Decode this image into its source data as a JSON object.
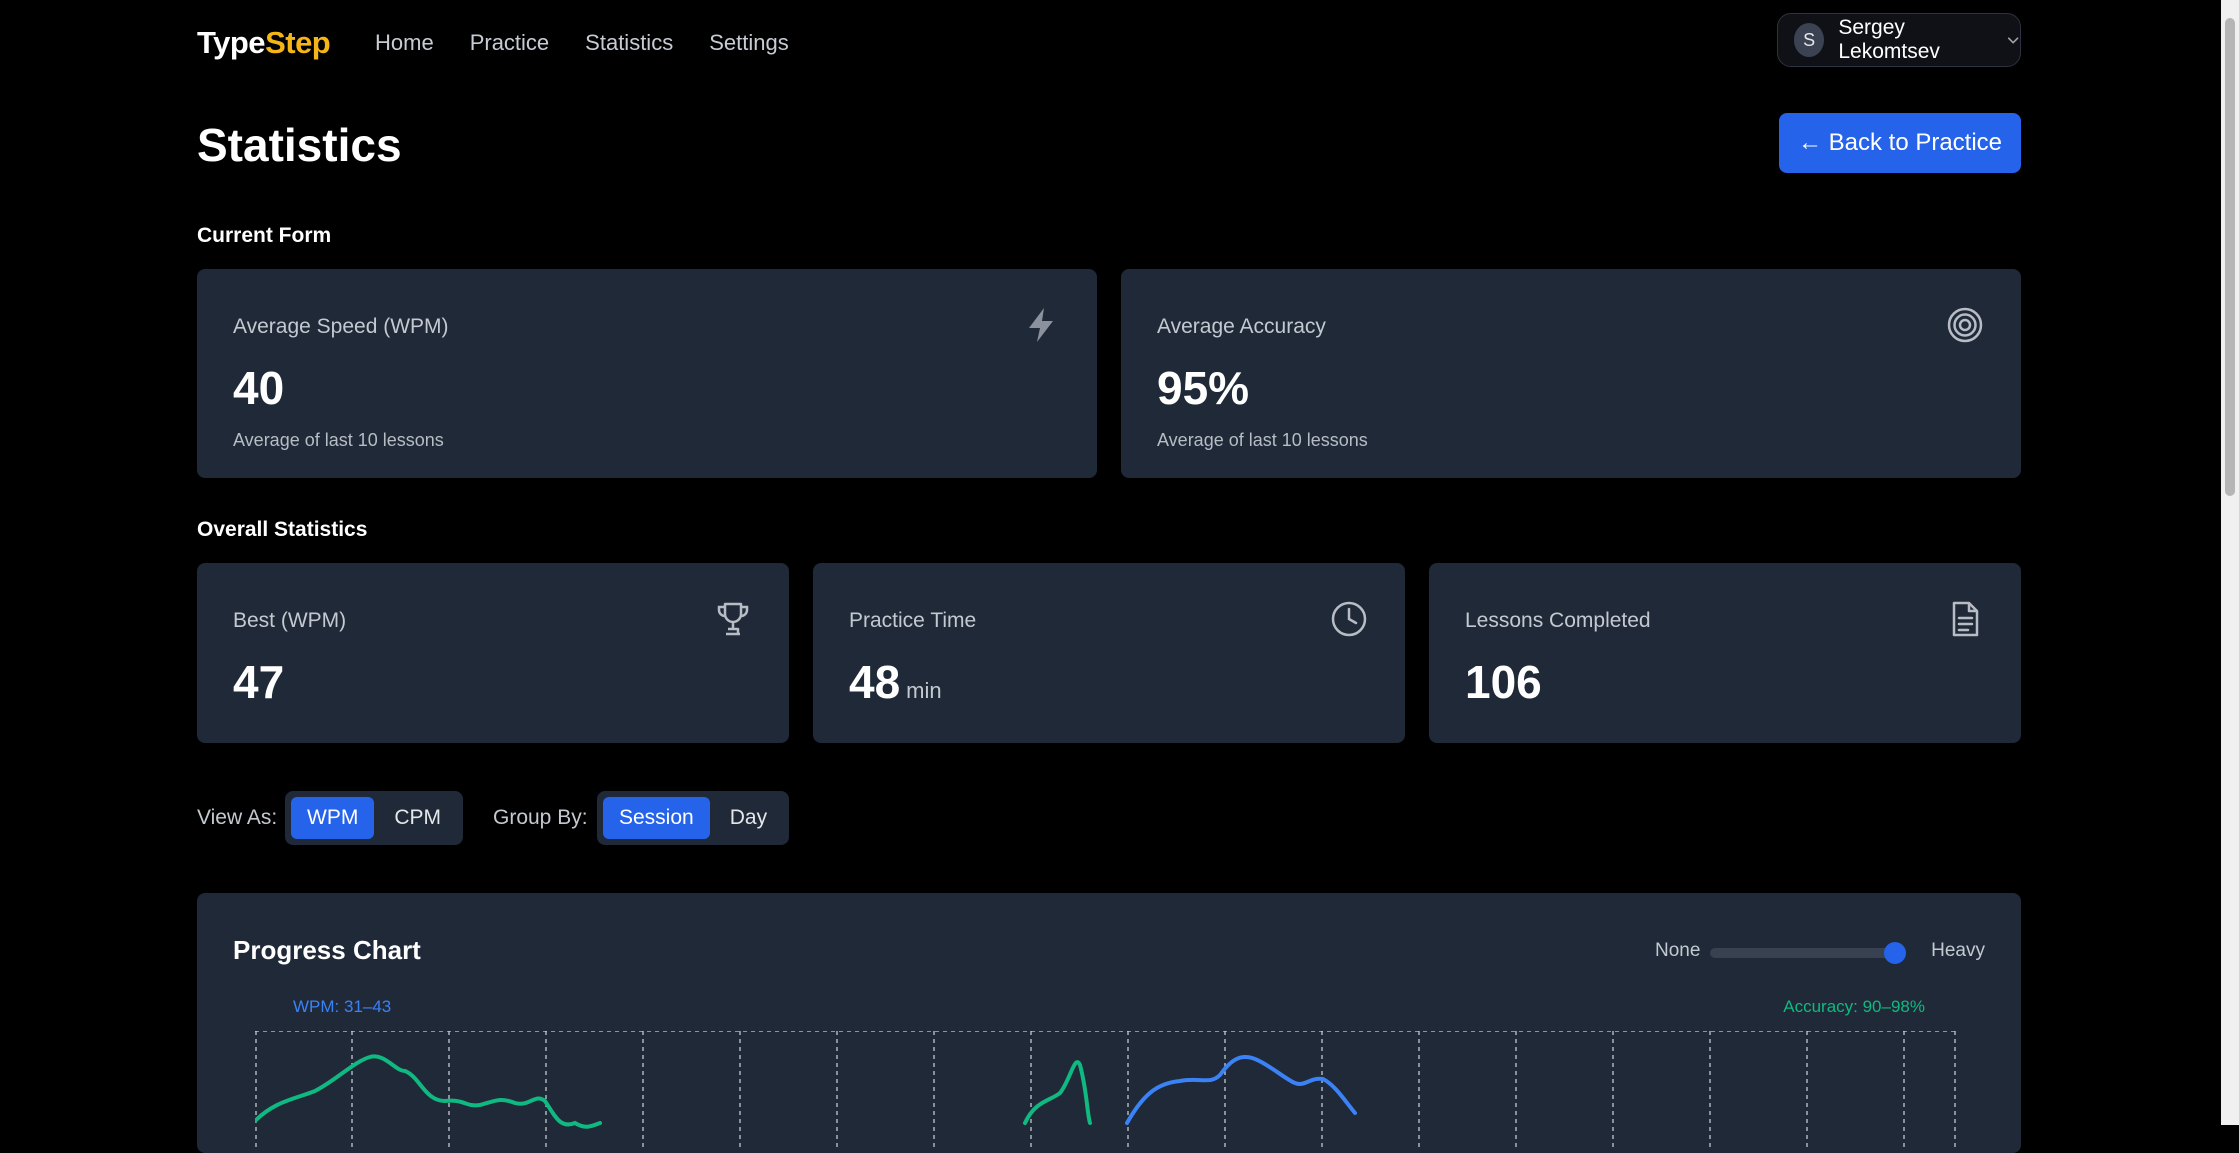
{
  "app": {
    "logo_part1": "Type",
    "logo_part2": "Step",
    "nav": [
      "Home",
      "Practice",
      "Statistics",
      "Settings"
    ],
    "user": {
      "initial": "S",
      "name": "Sergey Lekomtsev"
    }
  },
  "page": {
    "title": "Statistics",
    "back_button": "← Back to Practice"
  },
  "current_form": {
    "label": "Current Form",
    "cards": [
      {
        "label": "Average Speed (WPM)",
        "value": "40",
        "sub": "Average of last 10 lessons",
        "icon": "lightning-icon"
      },
      {
        "label": "Average Accuracy",
        "value": "95%",
        "sub": "Average of last 10 lessons",
        "icon": "target-icon"
      }
    ]
  },
  "overall": {
    "label": "Overall Statistics",
    "cards": [
      {
        "label": "Best (WPM)",
        "value": "47",
        "unit": "",
        "icon": "trophy-icon"
      },
      {
        "label": "Practice Time",
        "value": "48",
        "unit": "min",
        "icon": "clock-icon"
      },
      {
        "label": "Lessons Completed",
        "value": "106",
        "unit": "",
        "icon": "document-icon"
      }
    ]
  },
  "controls": {
    "view_as_label": "View As:",
    "view_as_options": [
      "WPM",
      "CPM"
    ],
    "view_as_selected": "WPM",
    "group_by_label": "Group By:",
    "group_by_options": [
      "Session",
      "Day"
    ],
    "group_by_selected": "Session"
  },
  "chart": {
    "title": "Progress Chart",
    "smoothing_min_label": "None",
    "smoothing_max_label": "Heavy",
    "smoothing_level": 1.0,
    "wpm_range_label": "WPM: 31–43",
    "accuracy_range_label": "Accuracy: 90–98%",
    "colors": {
      "wpm": "#3b82f6",
      "accuracy": "#10b981",
      "grid": "#d1d5db"
    }
  }
}
